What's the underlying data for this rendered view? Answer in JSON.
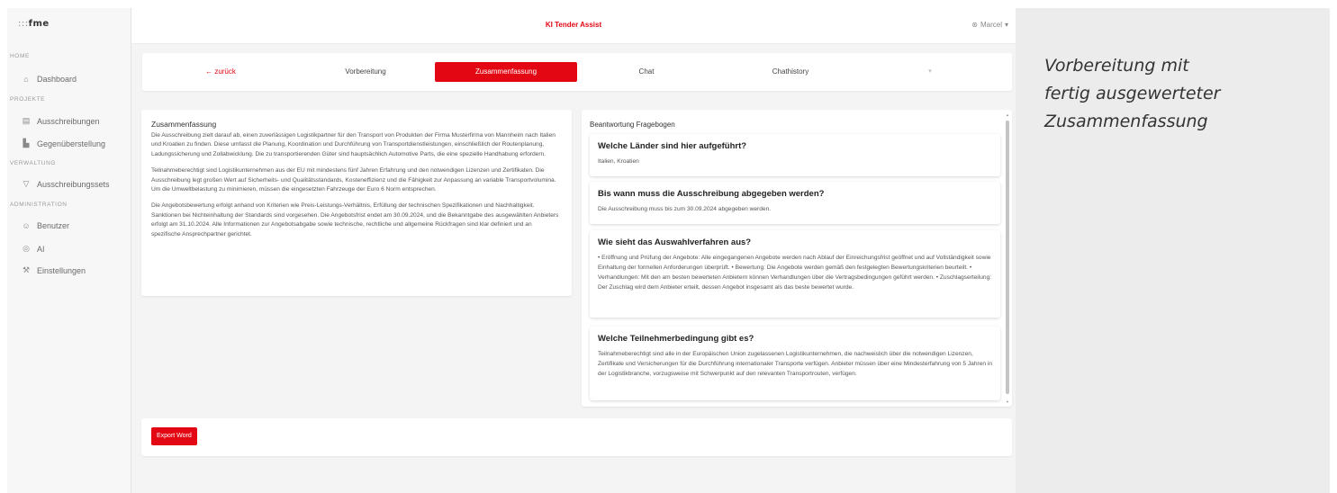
{
  "logo": "fme",
  "app_title": "KI Tender Assist",
  "user": {
    "name": "Marcel",
    "icon": "user-circle-icon",
    "chevron": "▾"
  },
  "sidebar": {
    "sections": [
      {
        "label": "HOME",
        "items": [
          {
            "label": "Dashboard",
            "icon": "home-icon"
          }
        ]
      },
      {
        "label": "PROJEKTE",
        "items": [
          {
            "label": "Ausschreibungen",
            "icon": "document-icon"
          },
          {
            "label": "Gegenüberstellung",
            "icon": "bar-chart-icon"
          }
        ]
      },
      {
        "label": "VERWALTUNG",
        "items": [
          {
            "label": "Ausschreibungssets",
            "icon": "filter-icon"
          }
        ]
      },
      {
        "label": "ADMINISTRATION",
        "items": [
          {
            "label": "Benutzer",
            "icon": "user-icon"
          },
          {
            "label": "AI",
            "icon": "ai-icon"
          },
          {
            "label": "Einstellungen",
            "icon": "wrench-icon"
          }
        ]
      }
    ]
  },
  "tabs": {
    "back": "← zurück",
    "items": [
      "Vorbereitung",
      "Zusammenfassung",
      "Chat",
      "Chathistory"
    ],
    "active": "Zusammenfassung",
    "more": "▾"
  },
  "summary": {
    "title": "Zusammenfassung",
    "paragraphs": [
      "Die Ausschreibung zielt darauf ab, einen zuverlässigen Logistikpartner für den Transport von Produkten der Firma Musterfirma von Mannheim nach Italien und Kroatien zu finden. Diese umfasst die Planung, Koordination und Durchführung von Transportdienstleistungen, einschließlich der Routenplanung, Ladungssicherung und Zollabwicklung. Die zu transportierenden Güter sind hauptsächlich Automotive Parts, die eine spezielle Handhabung erfordern.",
      "Teilnahmeberechtigt sind Logistikunternehmen aus der EU mit mindestens fünf Jahren Erfahrung und den notwendigen Lizenzen und Zertifikaten. Die Ausschreibung legt großen Wert auf Sicherheits- und Qualitätsstandards, Kosteneffizienz und die Fähigkeit zur Anpassung an variable Transportvolumina. Um die Umweltbelastung zu minimieren, müssen die eingesetzten Fahrzeuge der Euro 6 Norm entsprechen.",
      "Die Angebotsbewertung erfolgt anhand von Kriterien wie Preis-Leistungs-Verhältnis, Erfüllung der technischen Spezifikationen und Nachhaltigkeit. Sanktionen bei Nichteinhaltung der Standards sind vorgesehen. Die Angebotsfrist endet am 30.09.2024, und die Bekanntgabe des ausgewählten Anbieters erfolgt am 31.10.2024. Alle Informationen zur Angebotsabgabe sowie technische, rechtliche und allgemeine Rückfragen sind klar definiert und an spezifische Ansprechpartner gerichtet."
    ]
  },
  "qa": {
    "title": "Beantwortung Fragebogen",
    "items": [
      {
        "question": "Welche Länder sind hier aufgeführt?",
        "answer": "Italien, Kroatien"
      },
      {
        "question": "Bis wann muss die Ausschreibung abgegeben werden?",
        "answer": "Die Ausschreibung muss bis zum 30.09.2024 abgegeben werden."
      },
      {
        "question": "Wie sieht das Auswahlverfahren aus?",
        "answer": "• Eröffnung und Prüfung der Angebote: Alle eingegangenen Angebote werden nach Ablauf der Einreichungsfrist geöffnet und auf Vollständigkeit sowie Einhaltung der formellen Anforderungen überprüft. • Bewertung: Die Angebote werden gemäß den festgelegten Bewertungskriterien beurteilt. • Verhandlungen: Mit den am besten bewerteten Anbietern können Verhandlungen über die Vertragsbedingungen geführt werden. • Zuschlagserteilung: Der Zuschlag wird dem Anbieter erteilt, dessen Angebot insgesamt als das beste bewertet wurde."
      },
      {
        "question": "Welche Teilnehmerbedingung gibt es?",
        "answer": "Teilnahmeberechtigt sind alle in der Europäischen Union zugelassenen Logistikunternehmen, die nachweislich über die notwendigen Lizenzen, Zertifikate und Versicherungen für die Durchführung internationaler Transporte verfügen. Anbieter müssen über eine Mindesterfahrung von 5 Jahren in der Logistikbranche, vorzugsweise mit Schwerpunkt auf den relevanten Transportrouten, verfügen."
      }
    ]
  },
  "export_label": "Export Word",
  "caption": [
    "Vorbereitung mit",
    "fertig ausgewerteter",
    "Zusammenfassung"
  ],
  "colors": {
    "accent": "#e30613"
  }
}
